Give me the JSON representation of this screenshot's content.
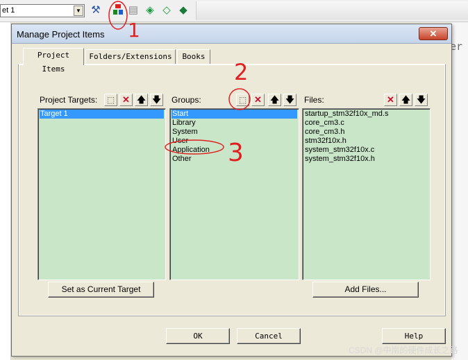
{
  "ide": {
    "target_value": "et 1",
    "toolbar_icons": [
      "rebuild-icon",
      "manage-project-items-icon",
      "file-extensions-icon",
      "options-icon",
      "download-icon",
      "debug-icon"
    ],
    "background_text": "er"
  },
  "dialog": {
    "title": "Manage Project Items",
    "close_glyph": "✕",
    "tabs": [
      {
        "label": "Project Items",
        "active": true
      },
      {
        "label": "Folders/Extensions",
        "active": false
      },
      {
        "label": "Books",
        "active": false
      }
    ],
    "targets": {
      "label": "Project Targets:",
      "items": [
        "Target 1"
      ],
      "selected_index": 0
    },
    "groups": {
      "label": "Groups:",
      "items": [
        "Start",
        "Library",
        "System",
        "User",
        "Application",
        "Other"
      ],
      "selected_index": 0
    },
    "files": {
      "label": "Files:",
      "items": [
        "startup_stm32f10x_md.s",
        "core_cm3.c",
        "core_cm3.h",
        "stm32f10x.h",
        "system_stm32f10x.c",
        "system_stm32f10x.h"
      ]
    },
    "buttons": {
      "set_current_target": "Set as Current Target",
      "add_files": "Add Files...",
      "ok": "OK",
      "cancel": "Cancel",
      "help": "Help"
    },
    "glyphs": {
      "new": "⬚",
      "delete": "✕",
      "up": "🡅",
      "down": "🡇"
    }
  },
  "annotations": {
    "step_1": "1",
    "step_2": "2",
    "step_3": "3",
    "color": "#e02020"
  },
  "watermark": "CSDN @中南的硬件成长之路",
  "colors": {
    "list_background": "#c9e6c9",
    "selection": "#3399ff",
    "dialog_face": "#ece9d8"
  }
}
